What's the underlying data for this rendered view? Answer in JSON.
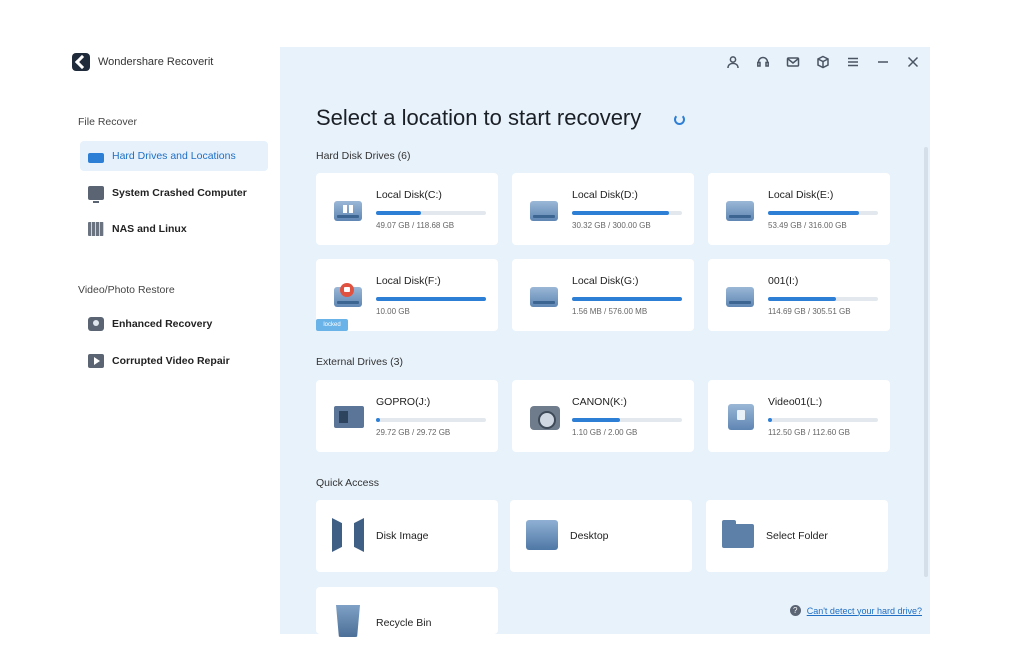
{
  "app": {
    "name": "Wondershare Recoverit"
  },
  "sidebar": {
    "sections": [
      {
        "title": "File Recover"
      },
      {
        "title": "Video/Photo Restore"
      }
    ],
    "items": [
      {
        "label": "Hard Drives and Locations",
        "icon": "hard-drive-icon",
        "active": true
      },
      {
        "label": "System Crashed Computer",
        "icon": "monitor-icon"
      },
      {
        "label": "NAS and Linux",
        "icon": "nas-icon"
      },
      {
        "label": "Enhanced Recovery",
        "icon": "camera-icon"
      },
      {
        "label": "Corrupted Video Repair",
        "icon": "video-repair-icon"
      }
    ]
  },
  "topbar": {
    "icons": [
      "user-icon",
      "support-icon",
      "mail-icon",
      "cube-icon",
      "menu-icon",
      "minimize-icon",
      "close-icon"
    ]
  },
  "main": {
    "title": "Select a location to start recovery",
    "hard_disks": {
      "title": "Hard Disk Drives (6)",
      "items": [
        {
          "name": "Local Disk(C:)",
          "size": "49.07 GB / 118.68 GB",
          "used_fraction": 0.41
        },
        {
          "name": "Local Disk(D:)",
          "size": "30.32 GB / 300.00 GB",
          "used_fraction": 0.88
        },
        {
          "name": "Local Disk(E:)",
          "size": "53.49 GB / 316.00 GB",
          "used_fraction": 0.83
        },
        {
          "name": "Local Disk(F:)",
          "size": "10.00 GB",
          "used_fraction": 1.0,
          "locked": true,
          "tag": "locked"
        },
        {
          "name": "Local Disk(G:)",
          "size": "1.56 MB / 576.00 MB",
          "used_fraction": 1.0
        },
        {
          "name": "001(I:)",
          "size": "114.69 GB / 305.51 GB",
          "used_fraction": 0.62
        }
      ]
    },
    "external": {
      "title": "External Drives (3)",
      "items": [
        {
          "name": "GOPRO(J:)",
          "size": "29.72 GB / 29.72 GB",
          "used_fraction": 0.04
        },
        {
          "name": "CANON(K:)",
          "size": "1.10 GB / 2.00 GB",
          "used_fraction": 0.44
        },
        {
          "name": "Video01(L:)",
          "size": "112.50 GB / 112.60 GB",
          "used_fraction": 0.04
        }
      ]
    },
    "quick_access": {
      "title": "Quick Access",
      "items": [
        {
          "name": "Disk Image"
        },
        {
          "name": "Desktop"
        },
        {
          "name": "Select Folder"
        },
        {
          "name": "Recycle Bin"
        }
      ]
    },
    "help": {
      "text": "Can't detect your hard drive?",
      "icon_glyph": "?"
    }
  },
  "colors": {
    "accent": "#2d7fd6",
    "main_bg": "#e8f2fb",
    "active_bg": "#e6f1fc"
  }
}
